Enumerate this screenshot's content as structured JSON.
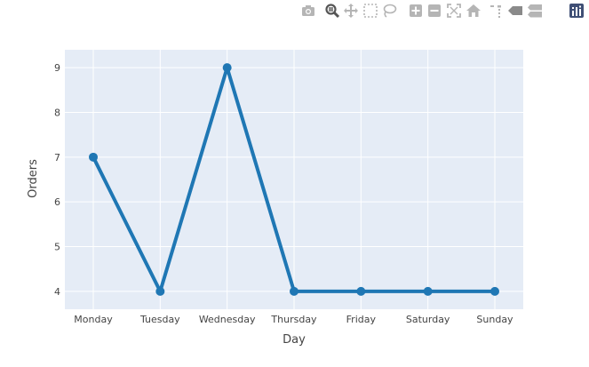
{
  "modebar": {
    "buttons": [
      {
        "name": "camera-icon"
      },
      {
        "name": "zoom-icon"
      },
      {
        "name": "pan-icon"
      },
      {
        "name": "box-select-icon"
      },
      {
        "name": "lasso-select-icon"
      },
      {
        "name": "zoom-in-icon"
      },
      {
        "name": "zoom-out-icon"
      },
      {
        "name": "autoscale-icon"
      },
      {
        "name": "reset-axes-icon"
      },
      {
        "name": "spike-lines-icon"
      },
      {
        "name": "hover-closest-icon"
      },
      {
        "name": "hover-compare-icon"
      },
      {
        "name": "plotly-logo-icon"
      }
    ]
  },
  "chart_data": {
    "type": "line",
    "categories": [
      "Monday",
      "Tuesday",
      "Wednesday",
      "Thursday",
      "Friday",
      "Saturday",
      "Sunday"
    ],
    "series": [
      {
        "values": [
          7,
          4,
          9,
          4,
          4,
          4,
          4
        ],
        "color": "#1f77b4"
      }
    ],
    "xlabel": "Day",
    "ylabel": "Orders",
    "ylim": [
      3.6,
      9.4
    ],
    "yticks": [
      4,
      5,
      6,
      7,
      8,
      9
    ],
    "grid": true,
    "plot_bg": "#e5ecf6",
    "grid_color": "#ffffff"
  }
}
